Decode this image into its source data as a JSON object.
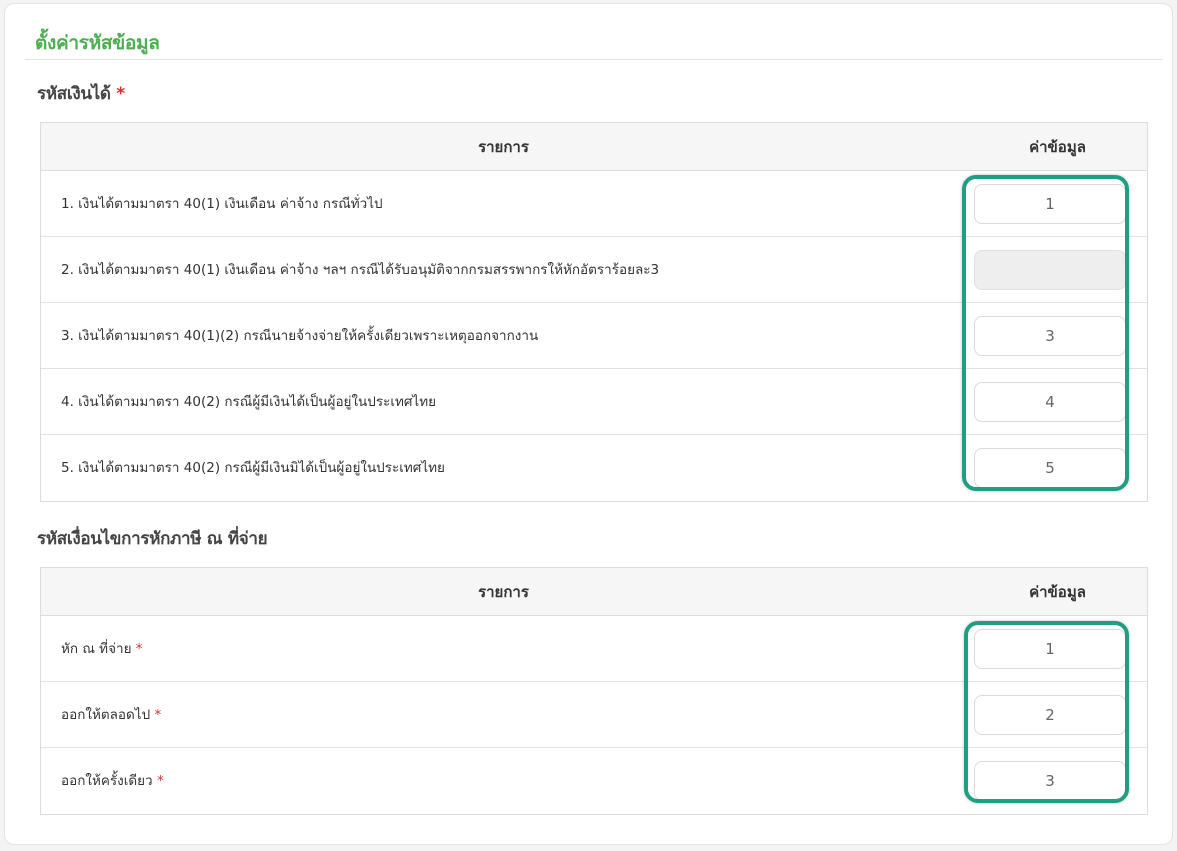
{
  "page_title": "ตั้งค่ารหัสข้อมูล",
  "section1": {
    "title": "รหัสเงินได้",
    "required_mark": "*",
    "col_item": "รายการ",
    "col_value": "ค่าข้อมูล",
    "rows": [
      {
        "label": "1. เงินได้ตามมาตรา 40(1) เงินเดือน ค่าจ้าง กรณีทั่วไป",
        "value": "1"
      },
      {
        "label": "2. เงินได้ตามมาตรา 40(1) เงินเดือน ค่าจ้าง ฯลฯ กรณีได้รับอนุมัติจากกรมสรรพากรให้หักอัตราร้อยละ3",
        "value": ""
      },
      {
        "label": "3. เงินได้ตามมาตรา 40(1)(2) กรณีนายจ้างจ่ายให้ครั้งเดียวเพราะเหตุออกจากงาน",
        "value": "3"
      },
      {
        "label": "4. เงินได้ตามมาตรา 40(2) กรณีผู้มีเงินได้เป็นผู้อยู่ในประเทศไทย",
        "value": "4"
      },
      {
        "label": "5. เงินได้ตามมาตรา 40(2) กรณีผู้มีเงินมิได้เป็นผู้อยู่ในประเทศไทย",
        "value": "5"
      }
    ]
  },
  "section2": {
    "title": "รหัสเงื่อนไขการหักภาษี ณ ที่จ่าย",
    "col_item": "รายการ",
    "col_value": "ค่าข้อมูล",
    "rows": [
      {
        "label": "หัก ณ ที่จ่าย",
        "required_mark": "*",
        "value": "1"
      },
      {
        "label": "ออกให้ตลอดไป",
        "required_mark": "*",
        "value": "2"
      },
      {
        "label": "ออกให้ครั้งเดียว",
        "required_mark": "*",
        "value": "3"
      }
    ]
  },
  "colors": {
    "title_green": "#4caf50",
    "highlight_teal": "#1f9e83",
    "required_red": "#d32f2f"
  }
}
